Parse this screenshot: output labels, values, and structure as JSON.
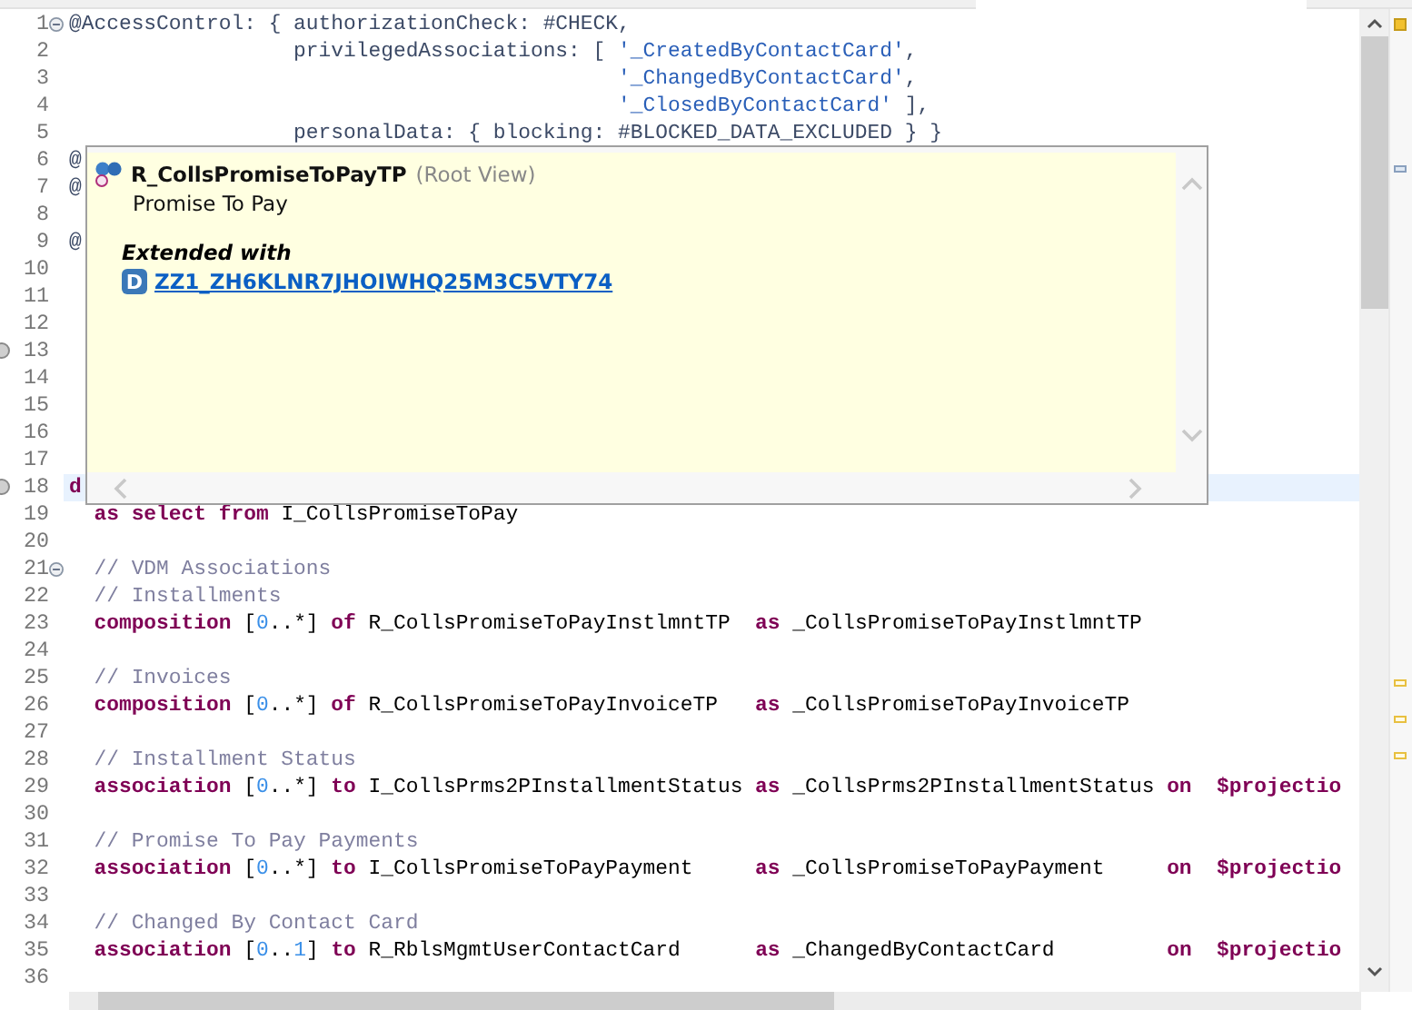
{
  "editor": {
    "lines": [
      {
        "number": "1",
        "expanded": true,
        "tokens": [
          {
            "kind": "annotation",
            "text": "@AccessControl: { authorizationCheck: #CHECK,"
          }
        ]
      },
      {
        "number": "2",
        "tokens": [
          {
            "kind": "annotation",
            "text": "                  privilegedAssociations: [ "
          },
          {
            "kind": "string",
            "text": "'_CreatedByContactCard'"
          },
          {
            "kind": "annotation",
            "text": ","
          }
        ]
      },
      {
        "number": "3",
        "tokens": [
          {
            "kind": "string",
            "text": "                                            '_ChangedByContactCard'"
          },
          {
            "kind": "annotation",
            "text": ","
          }
        ]
      },
      {
        "number": "4",
        "tokens": [
          {
            "kind": "string",
            "text": "                                            '_ClosedByContactCard'"
          },
          {
            "kind": "annotation",
            "text": " ],"
          }
        ]
      },
      {
        "number": "5",
        "tokens": [
          {
            "kind": "annotation",
            "text": "                  personalData: { blocking: #BLOCKED_DATA_EXCLUDED } }"
          }
        ]
      },
      {
        "number": "6",
        "tokens": [
          {
            "kind": "annotation",
            "text": "@"
          }
        ]
      },
      {
        "number": "7",
        "tokens": [
          {
            "kind": "annotation",
            "text": "@"
          }
        ]
      },
      {
        "number": "8"
      },
      {
        "number": "9",
        "tokens": [
          {
            "kind": "annotation",
            "text": "@"
          }
        ]
      },
      {
        "number": "10"
      },
      {
        "number": "11"
      },
      {
        "number": "12"
      },
      {
        "number": "13",
        "gutter_icon": true
      },
      {
        "number": "14"
      },
      {
        "number": "15"
      },
      {
        "number": "16"
      },
      {
        "number": "17"
      },
      {
        "number": "18",
        "gutter_icon": true,
        "current": true,
        "tokens": [
          {
            "kind": "keyword",
            "text": "d"
          }
        ]
      },
      {
        "number": "19",
        "tokens": [
          {
            "kind": "keyword",
            "text": "  as select from"
          },
          {
            "kind": "plain",
            "text": " I_CollsPromiseToPay"
          }
        ]
      },
      {
        "number": "20"
      },
      {
        "number": "21",
        "expanded": true,
        "tokens": [
          {
            "kind": "comment",
            "text": "  // VDM Associations"
          }
        ]
      },
      {
        "number": "22",
        "tokens": [
          {
            "kind": "comment",
            "text": "  // Installments"
          }
        ]
      },
      {
        "number": "23",
        "tokens": [
          {
            "kind": "keyword",
            "text": "  composition"
          },
          {
            "kind": "plain",
            "text": " ["
          },
          {
            "kind": "number",
            "text": "0"
          },
          {
            "kind": "plain",
            "text": "..*] "
          },
          {
            "kind": "keyword",
            "text": "of"
          },
          {
            "kind": "plain",
            "text": " R_CollsPromiseToPayInstlmntTP  "
          },
          {
            "kind": "keyword",
            "text": "as"
          },
          {
            "kind": "plain",
            "text": " _CollsPromiseToPayInstlmntTP"
          }
        ]
      },
      {
        "number": "24"
      },
      {
        "number": "25",
        "tokens": [
          {
            "kind": "comment",
            "text": "  // Invoices"
          }
        ]
      },
      {
        "number": "26",
        "tokens": [
          {
            "kind": "keyword",
            "text": "  composition"
          },
          {
            "kind": "plain",
            "text": " ["
          },
          {
            "kind": "number",
            "text": "0"
          },
          {
            "kind": "plain",
            "text": "..*] "
          },
          {
            "kind": "keyword",
            "text": "of"
          },
          {
            "kind": "plain",
            "text": " R_CollsPromiseToPayInvoiceTP   "
          },
          {
            "kind": "keyword",
            "text": "as"
          },
          {
            "kind": "plain",
            "text": " _CollsPromiseToPayInvoiceTP"
          }
        ]
      },
      {
        "number": "27"
      },
      {
        "number": "28",
        "tokens": [
          {
            "kind": "comment",
            "text": "  // Installment Status"
          }
        ]
      },
      {
        "number": "29",
        "tokens": [
          {
            "kind": "keyword",
            "text": "  association"
          },
          {
            "kind": "plain",
            "text": " ["
          },
          {
            "kind": "number",
            "text": "0"
          },
          {
            "kind": "plain",
            "text": "..*] "
          },
          {
            "kind": "keyword",
            "text": "to"
          },
          {
            "kind": "plain",
            "text": " I_CollsPrms2PInstallmentStatus "
          },
          {
            "kind": "keyword",
            "text": "as"
          },
          {
            "kind": "plain",
            "text": " _CollsPrms2PInstallmentStatus "
          },
          {
            "kind": "keyword",
            "text": "on  $projectio"
          }
        ]
      },
      {
        "number": "30"
      },
      {
        "number": "31",
        "tokens": [
          {
            "kind": "comment",
            "text": "  // Promise To Pay Payments"
          }
        ]
      },
      {
        "number": "32",
        "tokens": [
          {
            "kind": "keyword",
            "text": "  association"
          },
          {
            "kind": "plain",
            "text": " ["
          },
          {
            "kind": "number",
            "text": "0"
          },
          {
            "kind": "plain",
            "text": "..*] "
          },
          {
            "kind": "keyword",
            "text": "to"
          },
          {
            "kind": "plain",
            "text": " I_CollsPromiseToPayPayment     "
          },
          {
            "kind": "keyword",
            "text": "as"
          },
          {
            "kind": "plain",
            "text": " _CollsPromiseToPayPayment     "
          },
          {
            "kind": "keyword",
            "text": "on  $projectio"
          }
        ]
      },
      {
        "number": "33"
      },
      {
        "number": "34",
        "tokens": [
          {
            "kind": "comment",
            "text": "  // Changed By Contact Card"
          }
        ]
      },
      {
        "number": "35",
        "tokens": [
          {
            "kind": "keyword",
            "text": "  association"
          },
          {
            "kind": "plain",
            "text": " ["
          },
          {
            "kind": "number",
            "text": "0"
          },
          {
            "kind": "plain",
            "text": ".."
          },
          {
            "kind": "number",
            "text": "1"
          },
          {
            "kind": "plain",
            "text": "] "
          },
          {
            "kind": "keyword",
            "text": "to"
          },
          {
            "kind": "plain",
            "text": " R_RblsMgmtUserContactCard      "
          },
          {
            "kind": "keyword",
            "text": "as"
          },
          {
            "kind": "plain",
            "text": " _ChangedByContactCard         "
          },
          {
            "kind": "keyword",
            "text": "on  $projectio"
          }
        ]
      },
      {
        "number": "36"
      }
    ]
  },
  "hover_popup": {
    "title": "R_CollsPromiseToPayTP",
    "title_note": "(Root View)",
    "description": "Promise To Pay",
    "section_heading": "Extended with",
    "extensions": [
      {
        "badge": "D",
        "link": "ZZ1_ZH6KLNR7JHOIWHQ25M3C5VTY74"
      }
    ]
  }
}
